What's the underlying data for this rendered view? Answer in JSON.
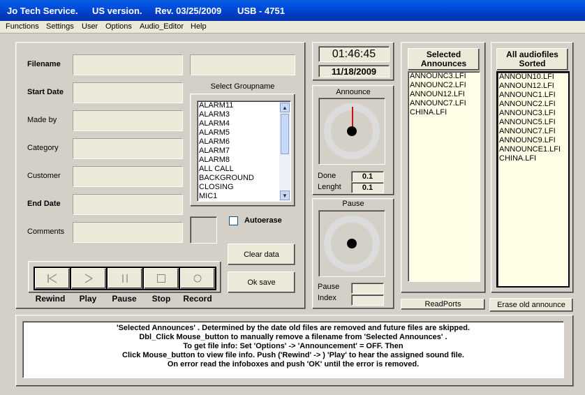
{
  "window": {
    "app_name": "Jo Tech Service.",
    "version": "US version.",
    "revision": "Rev. 03/25/2009",
    "usb": "USB - 4751"
  },
  "menu": [
    "Functions",
    "Settings",
    "User",
    "Options",
    "Audio_Editor",
    "Help"
  ],
  "form": {
    "filename_label": "Filename",
    "start_date_label": "Start Date",
    "made_by_label": "Made by",
    "category_label": "Category",
    "customer_label": "Customer",
    "end_date_label": "End Date",
    "comments_label": "Comments",
    "select_groupname_label": "Select Groupname",
    "autoerase_label": "Autoerase",
    "autoerase_checked": false
  },
  "groupnames": [
    "ALARM11",
    "ALARM3",
    "ALARM4",
    "ALARM5",
    "ALARM6",
    "ALARM7",
    "ALARM8",
    "ALL CALL",
    "BACKGROUND",
    "CLOSING",
    "MIC1"
  ],
  "buttons": {
    "clear_data": "Clear data",
    "ok_save": "Ok save",
    "read_ports": "ReadPorts",
    "erase_old": "Erase old announce"
  },
  "transport": {
    "rewind": "Rewind",
    "play": "Play",
    "pause": "Pause",
    "stop": "Stop",
    "record": "Record"
  },
  "clock": {
    "time": "01:46:45",
    "date": "11/18/2009"
  },
  "announce_panel": {
    "title": "Announce",
    "done_label": "Done",
    "done_value": "0.1",
    "length_label": "Lenght",
    "length_value": "0.1"
  },
  "pause_panel": {
    "title": "Pause",
    "pause_label": "Pause",
    "pause_value": "",
    "index_label": "Index",
    "index_value": ""
  },
  "selected_announces": {
    "title_line1": "Selected",
    "title_line2": "Announces",
    "items": [
      "ANNOUNC3.LFI",
      "ANNOUNC2.LFI",
      "ANNOUN12.LFI",
      "ANNOUNC7.LFI",
      "CHINA.LFI"
    ]
  },
  "all_audiofiles": {
    "title_line1": "All audiofiles",
    "title_line2": "Sorted",
    "items": [
      "ANNOUN10.LFI",
      "ANNOUN12.LFI",
      "ANNOUNC1.LFI",
      "ANNOUNC2.LFI",
      "ANNOUNC3.LFI",
      "ANNOUNC5.LFI",
      "ANNOUNC7.LFI",
      "ANNOUNC9.LFI",
      "ANNOUNCE1.LFI",
      "CHINA.LFI"
    ]
  },
  "info": [
    "'Selected Announces' .  Determined by the date old files are removed and future files are skipped.",
    "Dbl_Click Mouse_button to manually remove a filename from 'Selected Announces' .",
    "To get file info: Set 'Options' -> 'Announcement' = OFF. Then",
    "Click Mouse_button to view file info. Push  ('Rewind' -> )  'Play' to hear the assigned sound file.",
    "On error read the infoboxes and push 'OK' until the error is removed."
  ]
}
